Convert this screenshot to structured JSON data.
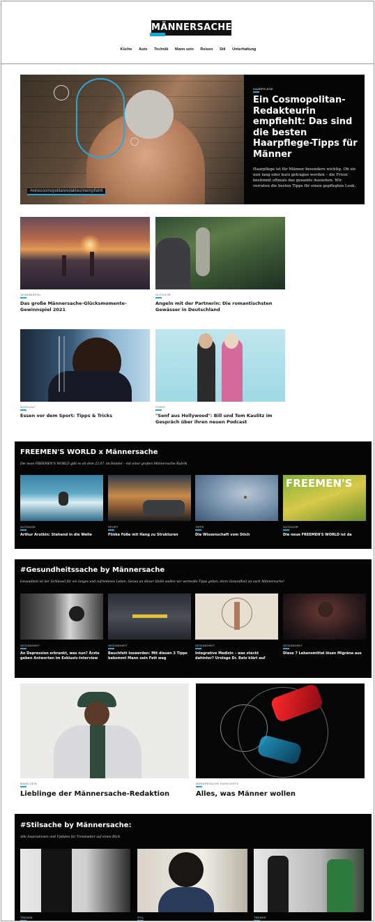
{
  "header": {
    "logo": "MÄNNERSACHE",
    "nav": [
      "Küche",
      "Auto",
      "Technik",
      "Mann sein",
      "Reisen",
      "Stil",
      "Unterhaltung"
    ]
  },
  "hero": {
    "hashtag": "#einecosmopolitanredakteurinempfiehlt",
    "kicker": "HAARPFLEGE",
    "title": "Ein Cosmopolitan-Redakteurin empfiehlt: Das sind die besten Haarpflege-Tipps für Männer",
    "desc": "Haarpflege ist für Männer besonders wichtig. Ob sie nun lang oder kurz getragen werden – die Frisur bestimmt oftmals das gesamte Aussehen. Wir verraten die besten Tipps für einen gepflegten Look."
  },
  "articles": [
    {
      "kicker": "GEWINNSPIEL",
      "title": "Das große Männersache-Glücksmomente-Gewinnspiel 2021"
    },
    {
      "kicker": "OUTDOOR",
      "title": "Angeln mit der Partnerin: Die romantischsten Gewässer in Deutschland"
    },
    {
      "kicker": "WORKOUT",
      "title": "Essen vor dem Sport: Tipps & Tricks"
    },
    {
      "kicker": "STARS",
      "title": "\"Senf aus Hollywood\": Bill und Tom Kaulitz im Gespräch über ihren neuen Podcast"
    }
  ],
  "freemens": {
    "title": "FREEMEN'S WORLD x Männersache",
    "sub": "Die neue FREEMEN'S WORLD gibt es ab dem 22.07. im Handel – mit einer großen Männersache-Rubrik",
    "magazine_brand": "FREEMEN'S",
    "items": [
      {
        "kicker": "OUTDOOR",
        "title": "Arthur Arutkin: Stehend in die Welle"
      },
      {
        "kicker": "SPORT",
        "title": "Flinke Füße mit Hang zu Strukturen"
      },
      {
        "kicker": "TIPPS",
        "title": "Die Wissenschaft vom Stich"
      },
      {
        "kicker": "OUTDOOR",
        "title": "Die neue FREEMEN'S WORLD ist da"
      }
    ]
  },
  "health": {
    "title": "#Gesundheitssache by Männersache",
    "sub": "Gesundheit ist der Schlüssel für ein langes und zufriedenes Leben. Genau an dieser Stelle wollen wir wertvolle Tipps geben, denn Gesundheit ist auch Männersache!",
    "items": [
      {
        "kicker": "GESUNDHEIT",
        "title": "An Depression erkrankt, was nun? Ärzte geben Antworten im Exklusiv-Interview"
      },
      {
        "kicker": "GESUNDHEIT",
        "title": "Bauchfett loswerden: Mit diesen 3 Tipps bekommt Mann sein Fett weg"
      },
      {
        "kicker": "GESUNDHEIT",
        "title": "Integrative Medizin – was steckt dahinter? Urologe Dr. Betz klärt auf"
      },
      {
        "kicker": "GESUNDHEIT",
        "title": "Diese 7 Lebensmittel lösen Migräne aus"
      }
    ]
  },
  "big": [
    {
      "kicker": "MANN SEIN",
      "title": "Lieblinge der Männersache-Redaktion"
    },
    {
      "kicker": "MÄNNERSACHE HIGHLIGHTS",
      "title": "Alles, was Männer wollen"
    }
  ],
  "style": {
    "title": "#Stilsache by Männersache:",
    "sub": "Alle Inspirationen und Updates für Trendsetter auf einen Blick",
    "kickers": [
      "TRENDS",
      "STIL",
      "TRENDS"
    ]
  }
}
